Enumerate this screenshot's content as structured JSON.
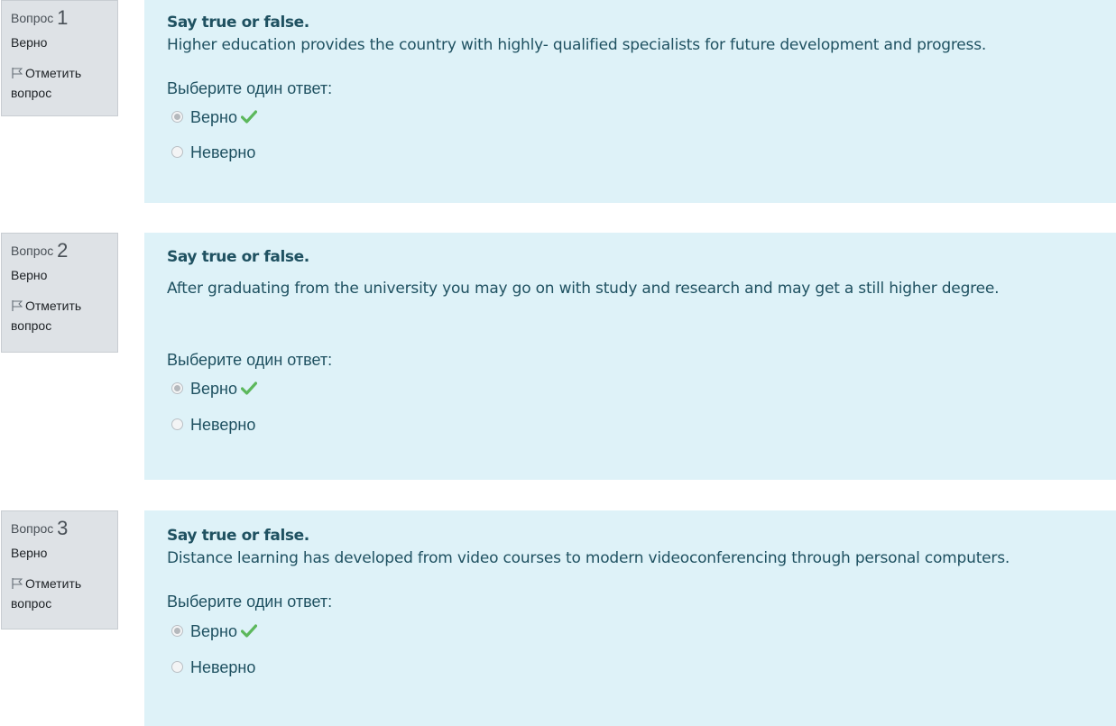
{
  "questions": [
    {
      "qword": "Вопрос",
      "number": "1",
      "state": "Верно",
      "flag_label": "Отметить вопрос",
      "title": "Say true or false.",
      "text": "Higher education provides the country with highly- qualified specialists for future development and progress.",
      "prompt": "Выберите один ответ:",
      "answers": [
        {
          "label": "Верно",
          "checked": true,
          "correct_icon": "check-icon"
        },
        {
          "label": "Неверно",
          "checked": false
        }
      ]
    },
    {
      "qword": "Вопрос",
      "number": "2",
      "state": "Верно",
      "flag_label": "Отметить вопрос",
      "title": "Say true or false.",
      "text": "After graduating from the university you may go on with study and research and may get a still higher degree.",
      "prompt": "Выберите один ответ:",
      "answers": [
        {
          "label": "Верно",
          "checked": true,
          "correct_icon": "check-icon"
        },
        {
          "label": "Неверно",
          "checked": false
        }
      ]
    },
    {
      "qword": "Вопрос",
      "number": "3",
      "state": "Верно",
      "flag_label": "Отметить вопрос",
      "title": "Say true or false.",
      "text": "Distance learning has developed from video courses to modern videoconferencing through personal computers.",
      "prompt": "Выберите один ответ:",
      "answers": [
        {
          "label": "Верно",
          "checked": true,
          "correct_icon": "check-icon"
        },
        {
          "label": "Неверно",
          "checked": false
        }
      ]
    }
  ],
  "colors": {
    "content_bg": "#def2f8",
    "info_bg": "#dee2e6",
    "text": "#1f5161",
    "correct": "#5cb85c"
  }
}
